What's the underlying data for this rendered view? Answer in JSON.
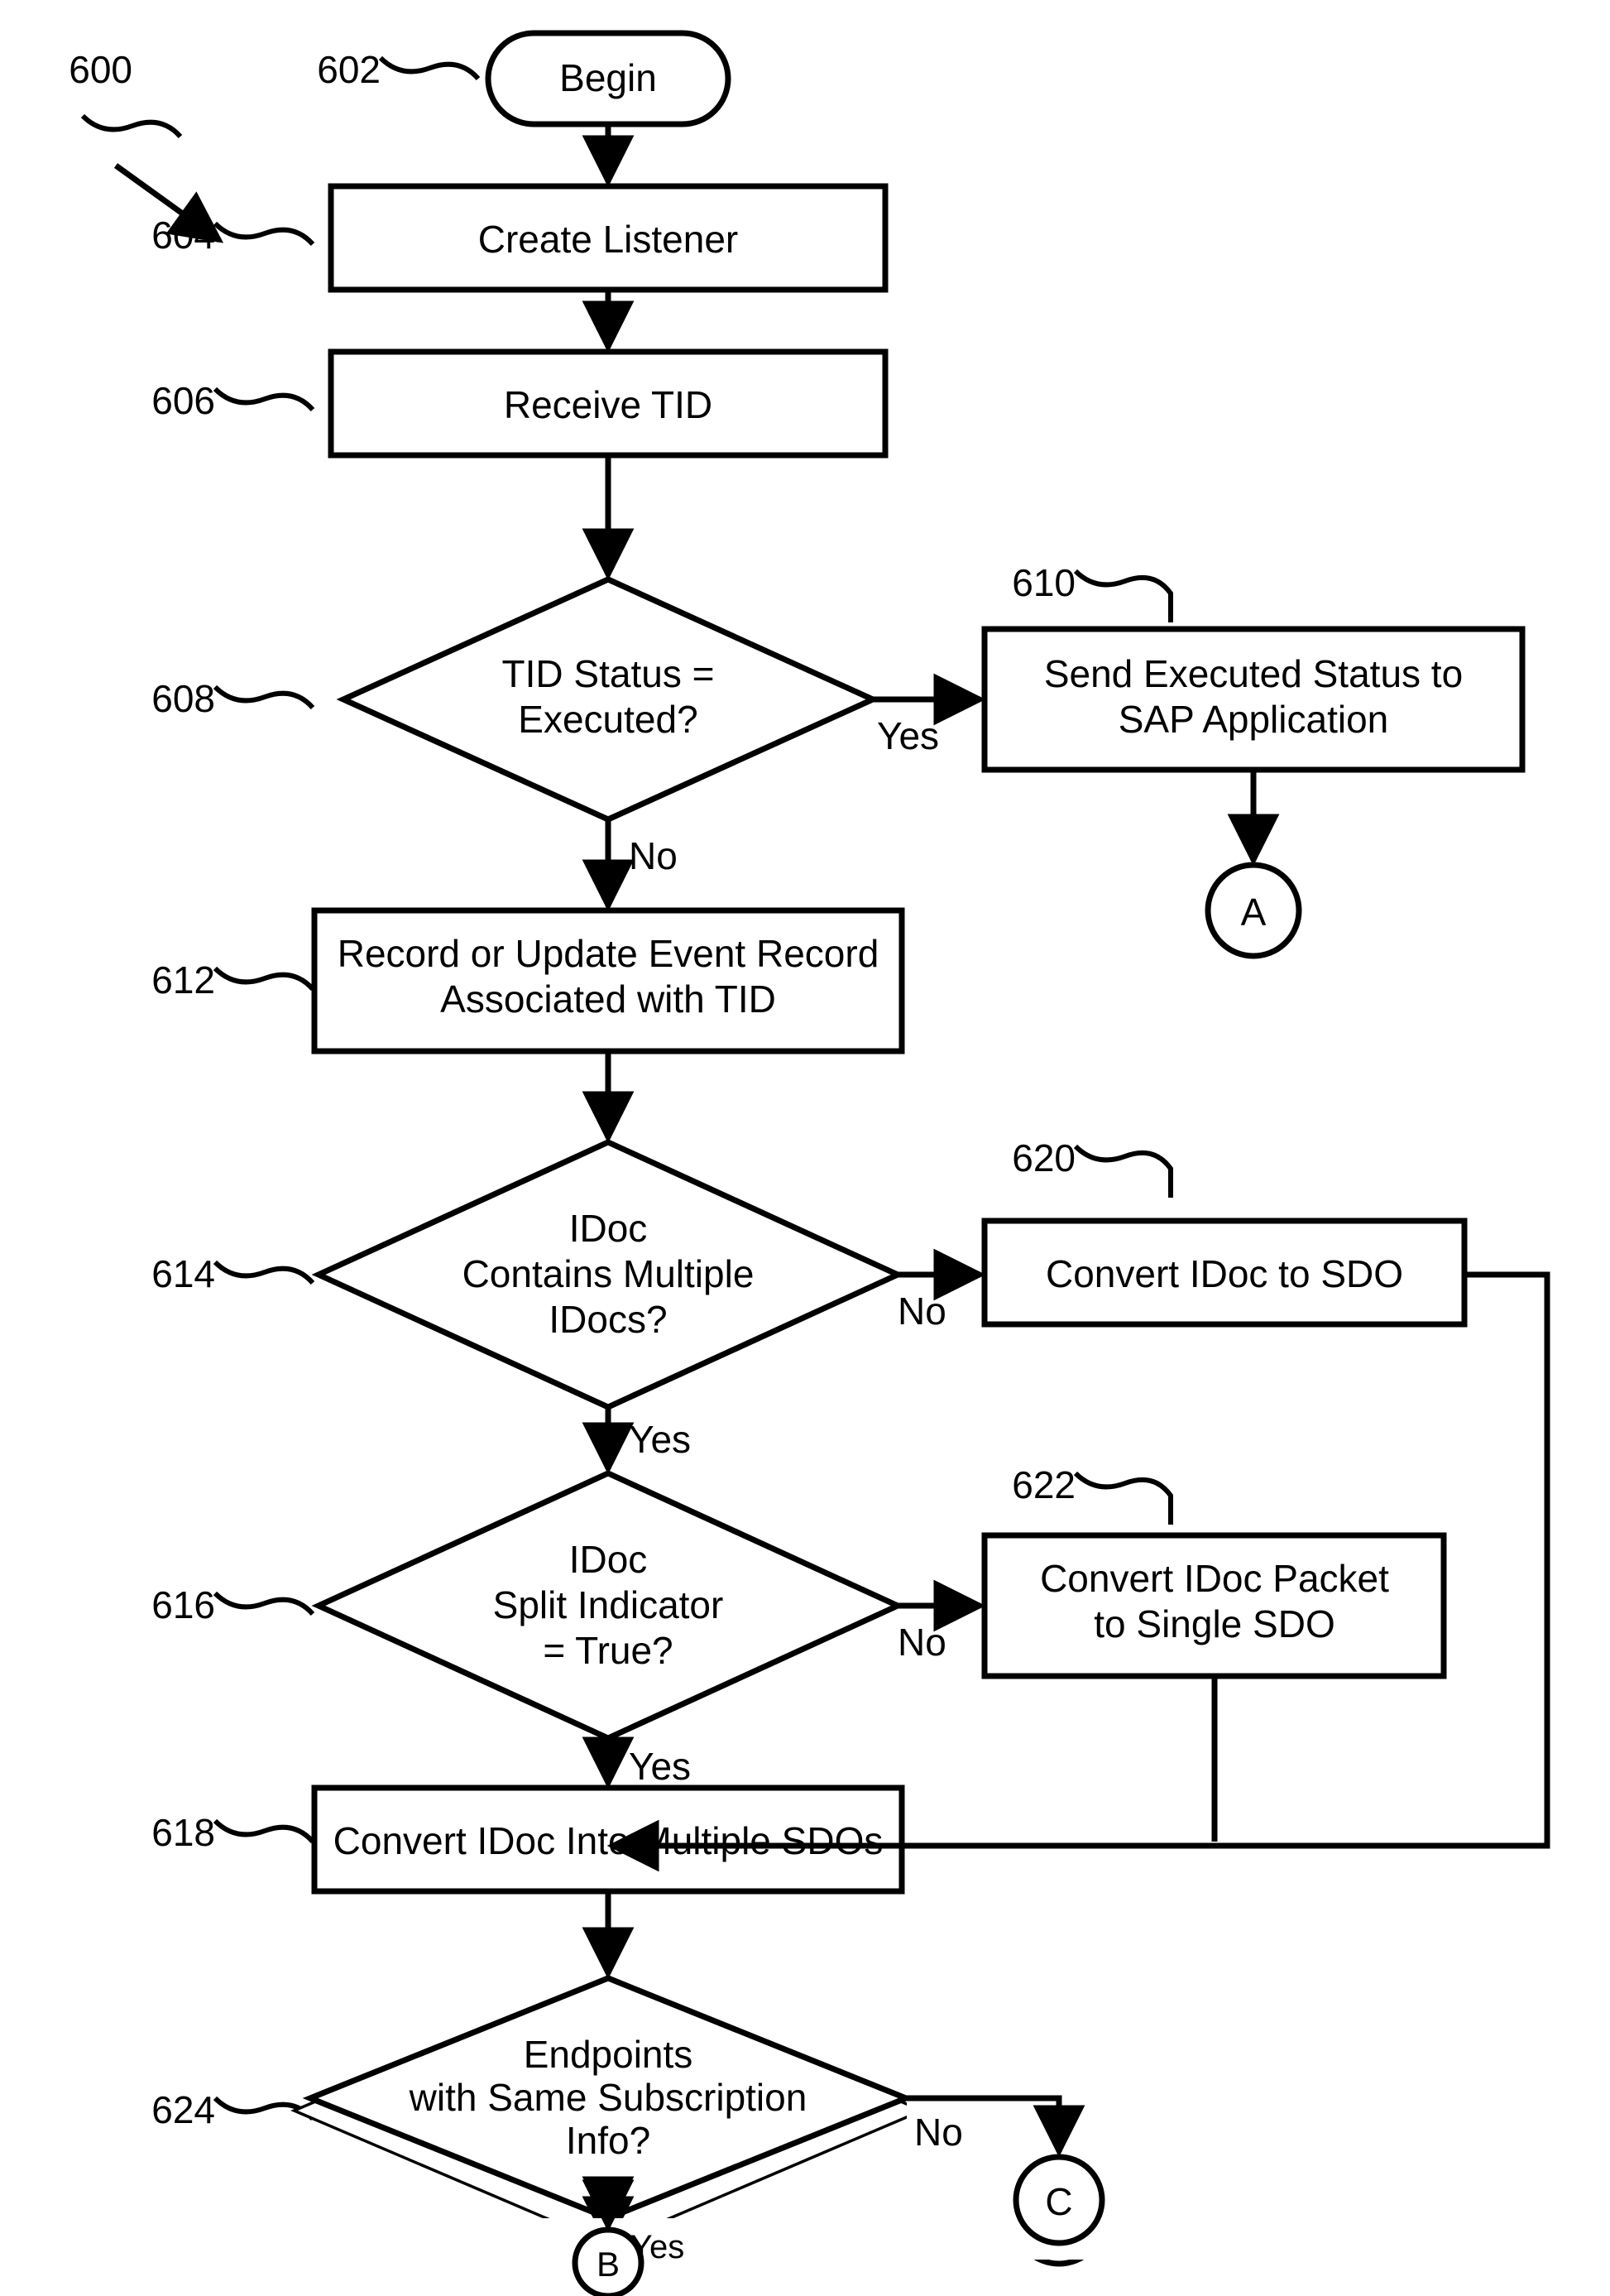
{
  "refs": {
    "r600": "600",
    "r602": "602",
    "r604": "604",
    "r606": "606",
    "r608": "608",
    "r610": "610",
    "r612": "612",
    "r614": "614",
    "r616": "616",
    "r618": "618",
    "r620": "620",
    "r622": "622",
    "r624": "624"
  },
  "nodes": {
    "begin": "Begin",
    "create_listener": "Create Listener",
    "receive_tid": "Receive TID",
    "tid_status_l1": "TID Status =",
    "tid_status_l2": "Executed?",
    "send_exec_l1": "Send Executed Status to",
    "send_exec_l2": "SAP Application",
    "record_l1": "Record or Update Event Record",
    "record_l2": "Associated with TID",
    "idoc_mult_l1": "IDoc",
    "idoc_mult_l2": "Contains Multiple",
    "idoc_mult_l3": "IDocs?",
    "convert_sdo": "Convert IDoc to SDO",
    "idoc_split_l1": "IDoc",
    "idoc_split_l2": "Split Indicator",
    "idoc_split_l3": "= True?",
    "convert_packet_l1": "Convert IDoc Packet",
    "convert_packet_l2": "to Single SDO",
    "convert_multi": "Convert IDoc Into Multiple SDOs",
    "endpoints_l1": "Endpoints",
    "endpoints_l2": "with Same Subscription",
    "endpoints_l3": "Info?",
    "conn_a": "A",
    "conn_b": "B",
    "conn_c": "C"
  },
  "edges": {
    "yes": "Yes",
    "no": "No"
  }
}
